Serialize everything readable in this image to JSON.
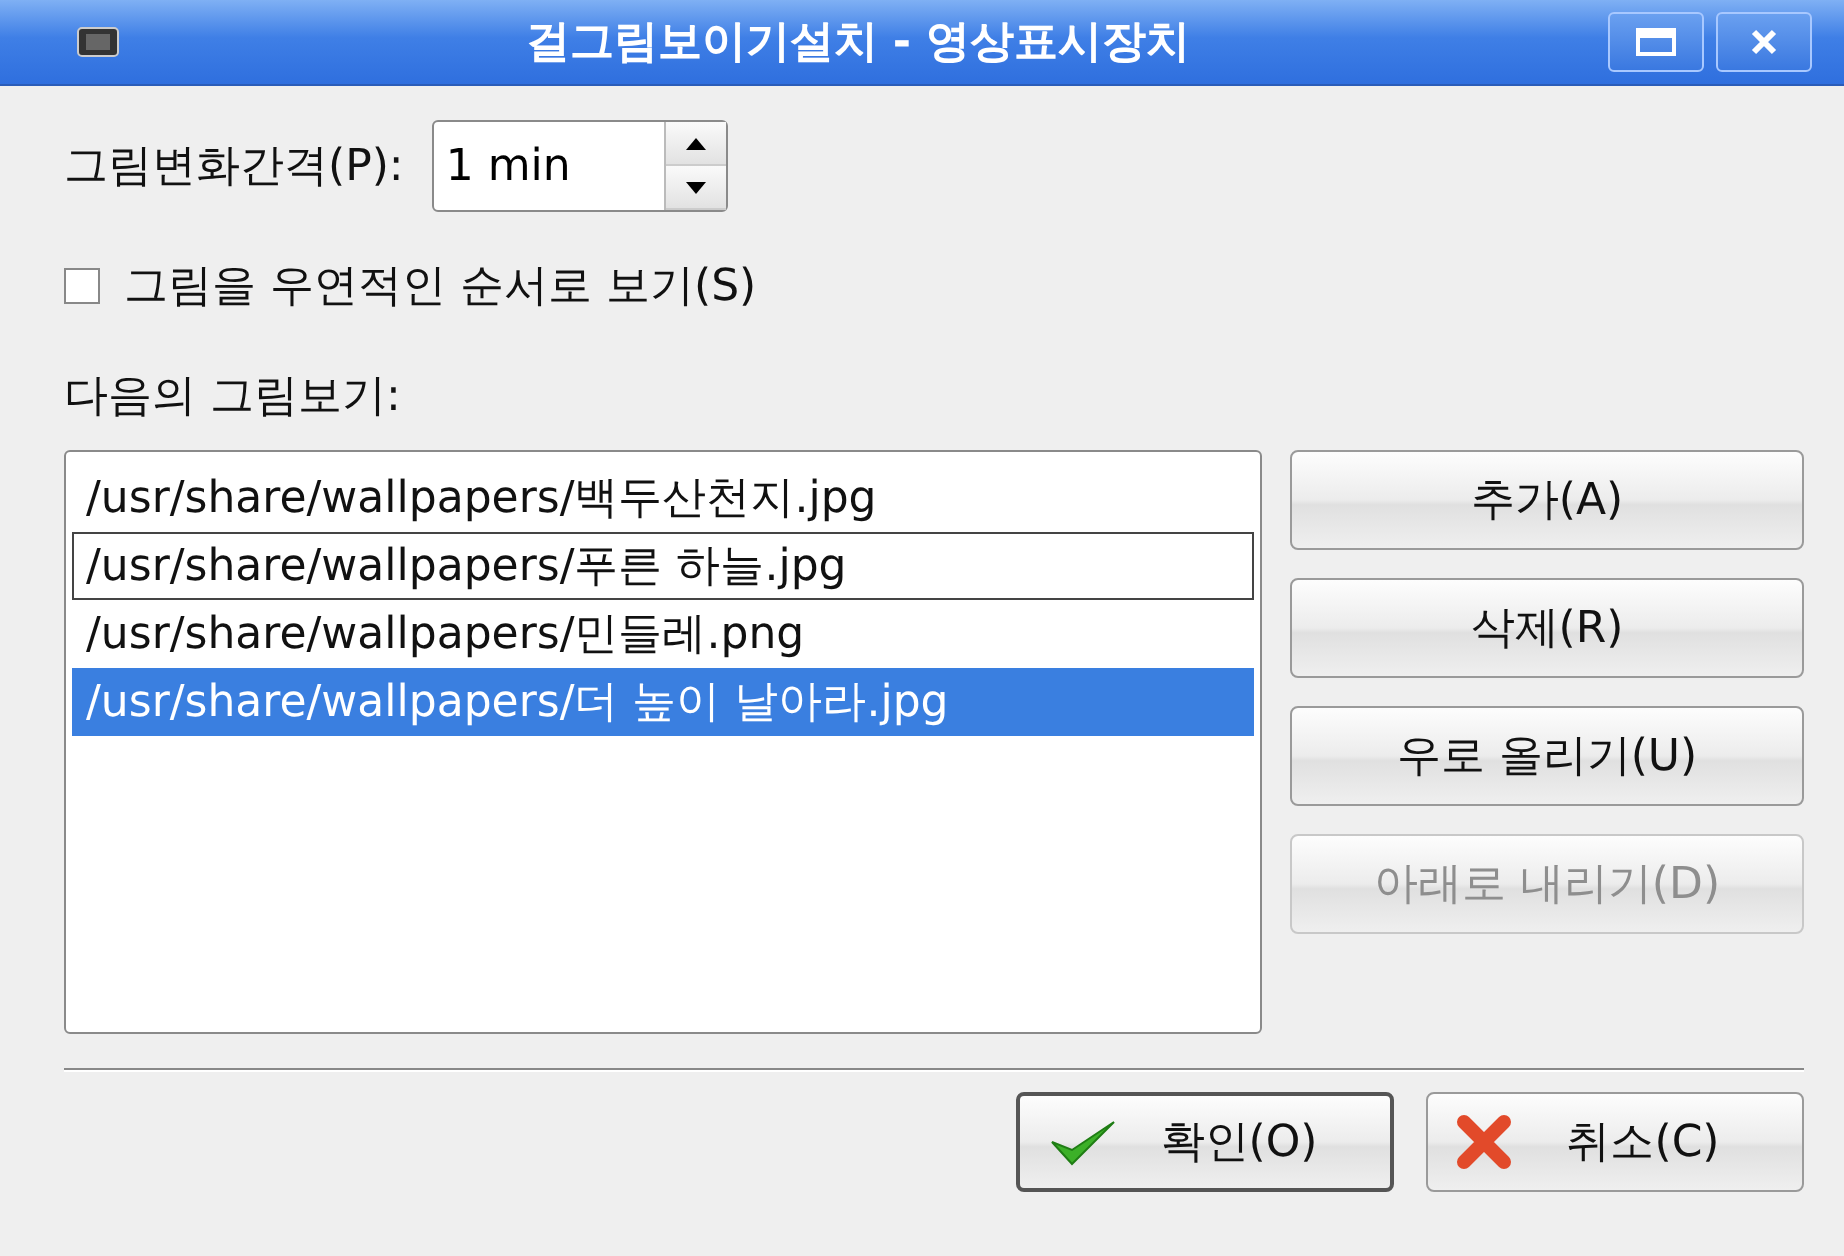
{
  "window": {
    "title": "걸그림보이기설치 - 영상표시장치"
  },
  "interval": {
    "label": "그림변화간격(P):",
    "value": "1 min"
  },
  "random_order": {
    "label": "그림을 우연적인 순서로 보기(S)",
    "checked": false
  },
  "list": {
    "label": "다음의 그림보기:",
    "items": [
      {
        "text": "/usr/share/wallpapers/백두산천지.jpg",
        "selected": false,
        "focused": false
      },
      {
        "text": "/usr/share/wallpapers/푸른 하늘.jpg",
        "selected": false,
        "focused": true
      },
      {
        "text": "/usr/share/wallpapers/민들레.png",
        "selected": false,
        "focused": false
      },
      {
        "text": "/usr/share/wallpapers/더 높이 날아라.jpg",
        "selected": true,
        "focused": false
      }
    ]
  },
  "side_buttons": [
    {
      "label": "추가(A)",
      "disabled": false
    },
    {
      "label": "삭제(R)",
      "disabled": false
    },
    {
      "label": "우로 올리기(U)",
      "disabled": false
    },
    {
      "label": "아래로 내리기(D)",
      "disabled": true
    }
  ],
  "buttons": [
    {
      "label": "확인(O)",
      "kind": "ok",
      "default": true
    },
    {
      "label": "취소(C)",
      "kind": "cancel",
      "default": false
    }
  ]
}
